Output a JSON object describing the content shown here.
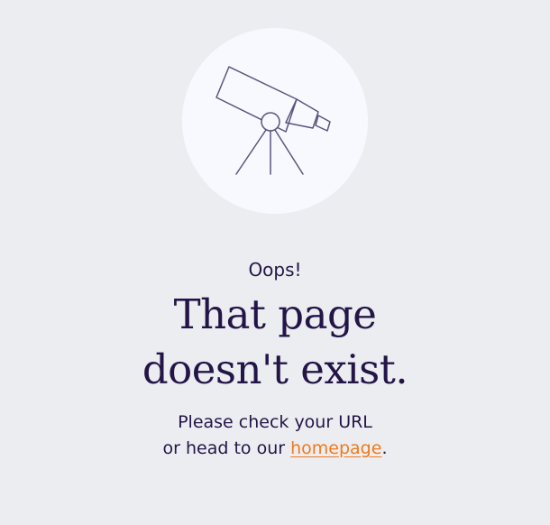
{
  "error": {
    "kicker": "Oops!",
    "headline_line1": "That page",
    "headline_line2": "doesn't exist.",
    "message_line1": "Please check your URL",
    "message_line2_prefix": "or head to our ",
    "homepage_link": "homepage",
    "message_line2_suffix": "."
  },
  "illustration": {
    "icon": "telescope-icon"
  },
  "colors": {
    "background": "#ecedf0",
    "circle": "#f8f9fe",
    "text": "#241548",
    "link": "#f07a1c",
    "stroke": "#5d5381"
  }
}
